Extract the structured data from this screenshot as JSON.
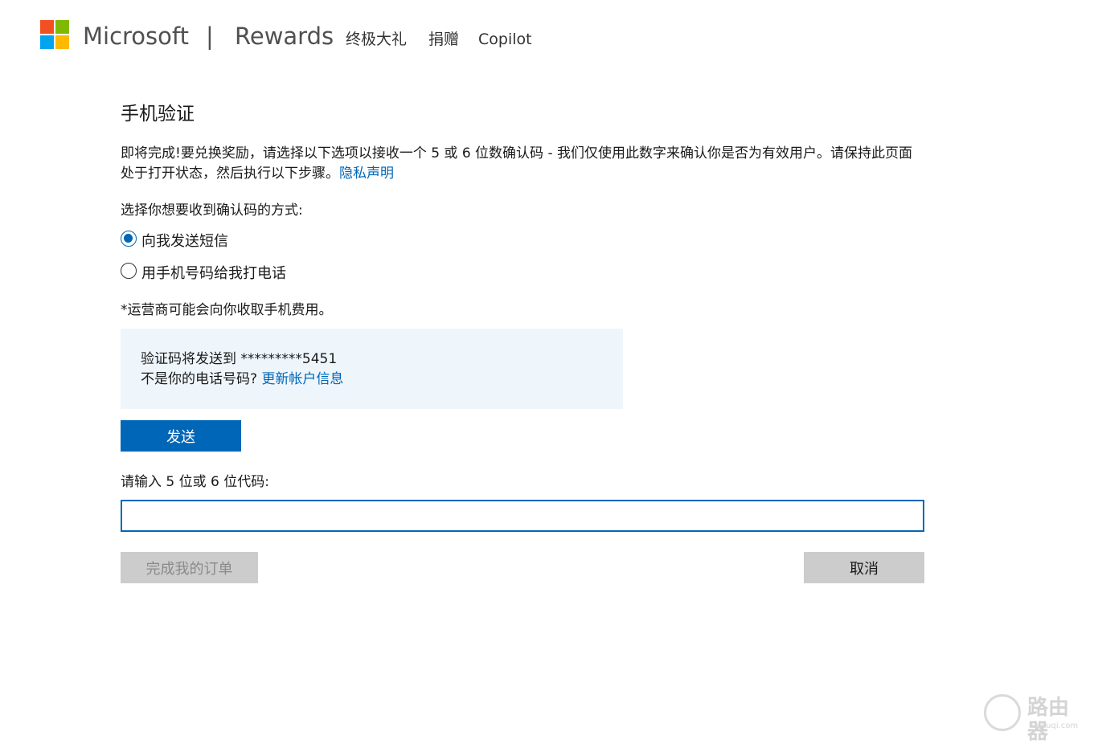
{
  "header": {
    "brand": "Microsoft",
    "divider": "|",
    "product": "Rewards",
    "nav": [
      {
        "label": "终极大礼"
      },
      {
        "label": "捐赠"
      },
      {
        "label": "Copilot"
      }
    ]
  },
  "main": {
    "title": "手机验证",
    "description": "即将完成!要兑换奖励，请选择以下选项以接收一个 5 或 6 位数确认码 - 我们仅使用此数字来确认你是否为有效用户。请保持此页面处于打开状态，然后执行以下步骤。",
    "privacy_link": "隐私声明",
    "choose_label": "选择你想要收到确认码的方式:",
    "options": [
      {
        "label": "向我发送短信",
        "selected": true
      },
      {
        "label": "用手机号码给我打电话",
        "selected": false
      }
    ],
    "carrier_note": "*运营商可能会向你收取手机费用。",
    "info": {
      "sent_to_label": "验证码将发送到",
      "masked_number": "*********5451",
      "not_your_number": "不是你的电话号码?",
      "update_link": "更新帐户信息"
    },
    "send_button": "发送",
    "code_label": "请输入 5 位或 6 位代码:",
    "code_value": "",
    "complete_button": "完成我的订单",
    "cancel_button": "取消"
  },
  "watermark": {
    "text": "路由器",
    "sub": "luyouqi.com"
  },
  "colors": {
    "accent": "#0067b8",
    "info_bg": "#eef6fc",
    "disabled_bg": "#cccccc"
  }
}
